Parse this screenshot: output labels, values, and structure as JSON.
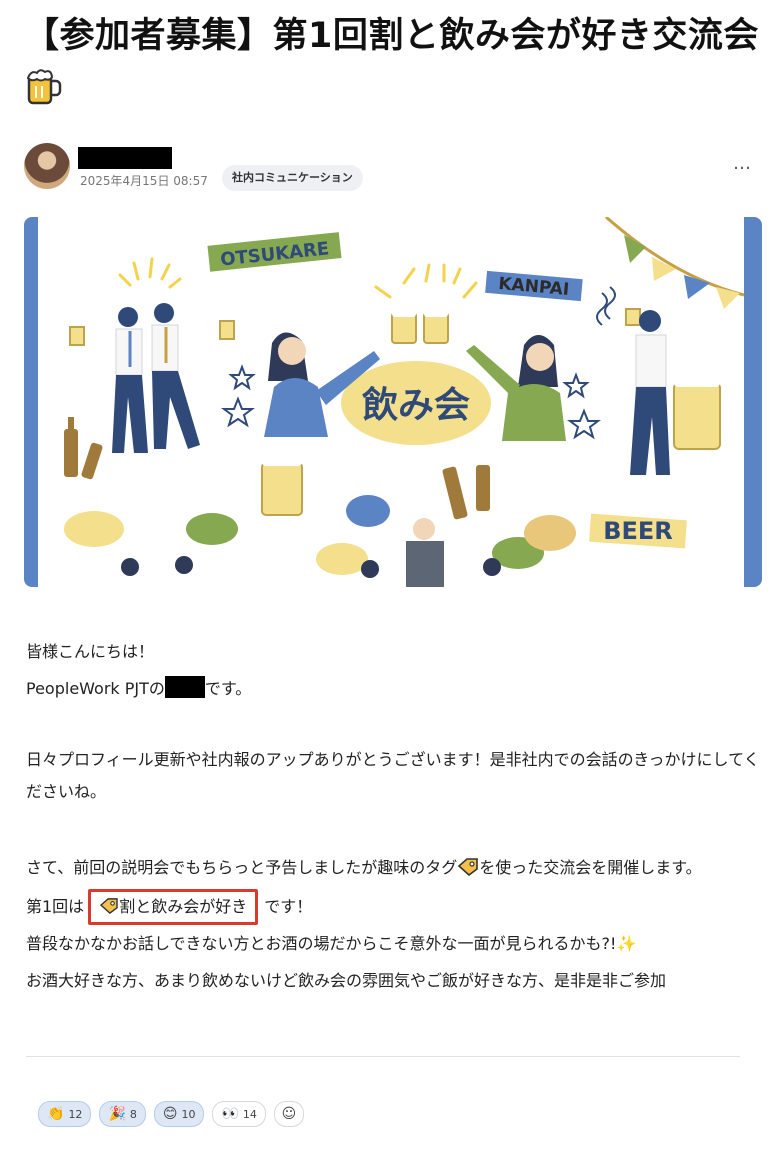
{
  "post": {
    "title": "【参加者募集】第1回割と飲み会が好き交流会",
    "date": "2025年4月15日 08:57",
    "category": "社内コミュニケーション",
    "more": "…"
  },
  "banner": {
    "words": {
      "otsukare": "OTSUKARE",
      "kanpai": "KANPAI",
      "beer": "BEER",
      "nomikai": "飲み会"
    },
    "colors": {
      "side_bar": "#5b84c4",
      "bubble_yellow": "#f3df8c",
      "green": "#86a851",
      "blue": "#2f4a78"
    }
  },
  "body": {
    "greeting": "皆様こんにちは！",
    "intro_before": "PeopleWork PJTの",
    "intro_after": "です。",
    "thanks": "日々プロフィール更新や社内報のアップありがとうございます！是非社内での会話のきっかけにしてくださいね。",
    "announce_before": "さて、前回の説明会でもちらっと予告しましたが趣味のタグ",
    "announce_after": "を使った交流会を開催します。",
    "first_before": "第1回は",
    "hashtag_label": "割と飲み会が好き",
    "first_after": "です！",
    "line_rare": "普段なかなかお話しできない方とお酒の場だからこそ意外な一面が見られるかも?!",
    "line_invite": "お酒大好きな方、あまり飲めないけど飲み会の雰囲気やご飯が好きな方、是非是非ご参加"
  },
  "reactions": [
    {
      "icon": "clap-icon",
      "glyph": "👏",
      "count": "12"
    },
    {
      "icon": "party-popper-icon",
      "glyph": "🎉",
      "count": "8"
    },
    {
      "icon": "smile-icon",
      "glyph": "😊",
      "count": "10"
    },
    {
      "icon": "eyes-icon",
      "glyph": "👀",
      "count": "14"
    }
  ],
  "add_reaction_glyph": "☺"
}
